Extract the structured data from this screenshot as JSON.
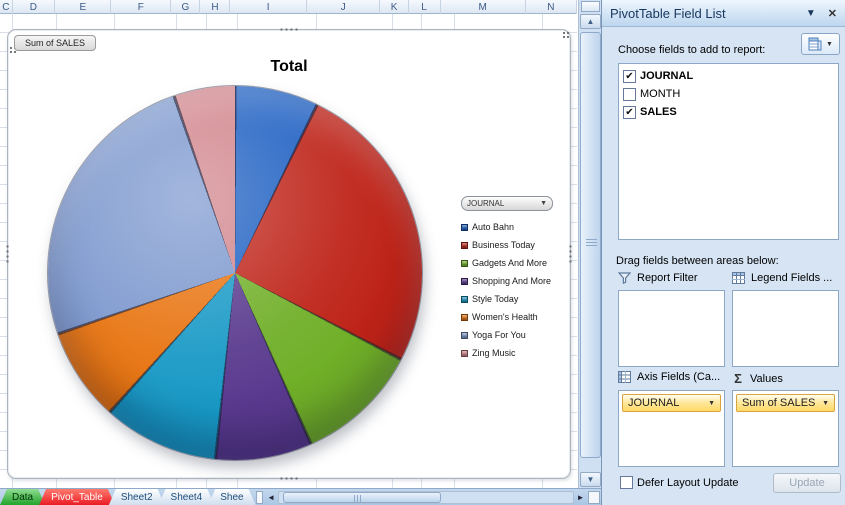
{
  "sheet": {
    "columns": [
      "C",
      "D",
      "E",
      "F",
      "G",
      "H",
      "I",
      "J",
      "K",
      "L",
      "M",
      "N"
    ],
    "tabs": [
      {
        "label": "Data",
        "style": "green"
      },
      {
        "label": "Pivot_Table",
        "style": "red"
      },
      {
        "label": "Sheet2",
        "style": "plain"
      },
      {
        "label": "Sheet4",
        "style": "plain"
      },
      {
        "label": "Shee",
        "style": "plain"
      }
    ],
    "scroll": {
      "left_arrow": "◄",
      "right_arrow": "►",
      "up_arrow": "▲",
      "down_arrow": "▼"
    }
  },
  "chart": {
    "field_button": "Sum of SALES",
    "title": "Total",
    "legend_dropdown": "JOURNAL",
    "dropdown_arrow": "▼"
  },
  "chart_data": {
    "type": "pie",
    "title": "Total",
    "value_field": "Sum of SALES",
    "category_field": "JOURNAL",
    "legend_position": "right",
    "slices": [
      {
        "label": "Auto Bahn",
        "percent": 7.2,
        "angle": 26,
        "color": "#1d5fc2"
      },
      {
        "label": "Business Today",
        "percent": 25.4,
        "angle": 91.5,
        "color": "#be2318"
      },
      {
        "label": "Gadgets And More",
        "percent": 10.7,
        "angle": 38.5,
        "color": "#70af28"
      },
      {
        "label": "Shopping And More",
        "percent": 8.3,
        "angle": 30,
        "color": "#59398e"
      },
      {
        "label": "Style Today",
        "percent": 10.0,
        "angle": 36,
        "color": "#1899c6"
      },
      {
        "label": "Women's Health",
        "percent": 8.1,
        "angle": 29,
        "color": "#e8730f"
      },
      {
        "label": "Yoga For You",
        "percent": 25.0,
        "angle": 90,
        "color": "#7b97ce"
      },
      {
        "label": "Zing Music",
        "percent": 5.3,
        "angle": 19,
        "color": "#d0838a"
      }
    ]
  },
  "panel": {
    "title": "PivotTable Field List",
    "menu_arrow": "▼",
    "close": "✕",
    "choose_label": "Choose fields to add to report:",
    "fields": [
      {
        "label": "JOURNAL",
        "checked": true
      },
      {
        "label": "MONTH",
        "checked": false
      },
      {
        "label": "SALES",
        "checked": true
      }
    ],
    "drag_label": "Drag fields between areas below:",
    "areas": {
      "report_filter": "Report Filter",
      "legend_fields": "Legend Fields ...",
      "axis_fields": "Axis Fields (Ca...",
      "values": "Values",
      "sigma": "Σ"
    },
    "axis_item": "JOURNAL",
    "values_item": "Sum of SALES",
    "defer_label": "Defer Layout Update",
    "update_label": "Update",
    "check_glyph": "✔"
  }
}
